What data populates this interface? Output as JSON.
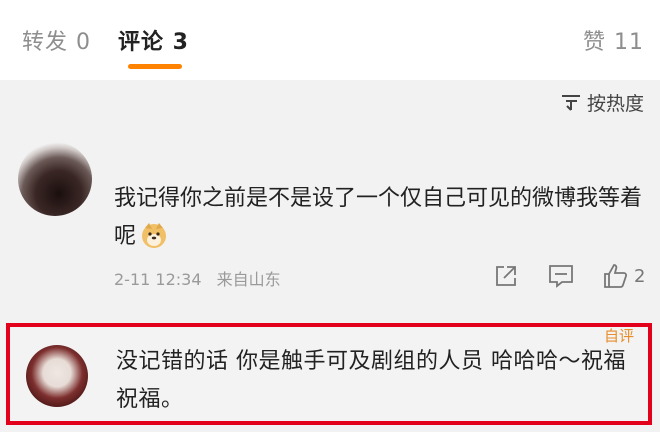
{
  "tabs": {
    "repost": "转发 0",
    "comment": "评论 3",
    "like": "赞 11"
  },
  "sort": {
    "label": "按热度",
    "icon": "sort-icon"
  },
  "comments": [
    {
      "text": "我记得你之前是不是设了一个仅自己可见的微博我等着呢",
      "emoji": "doge-emoji",
      "time": "2-11 12:34",
      "location": "来自山东",
      "like_count": "2"
    },
    {
      "author_tag": "自评",
      "text": "没记错的话 你是触手可及剧组的人员 哈哈哈～祝福祝福。",
      "highlight_color": "#e3001b"
    }
  ],
  "colors": {
    "accent": "#ff8200",
    "highlight": "#e3001b",
    "author_tag": "#e88d2c"
  }
}
